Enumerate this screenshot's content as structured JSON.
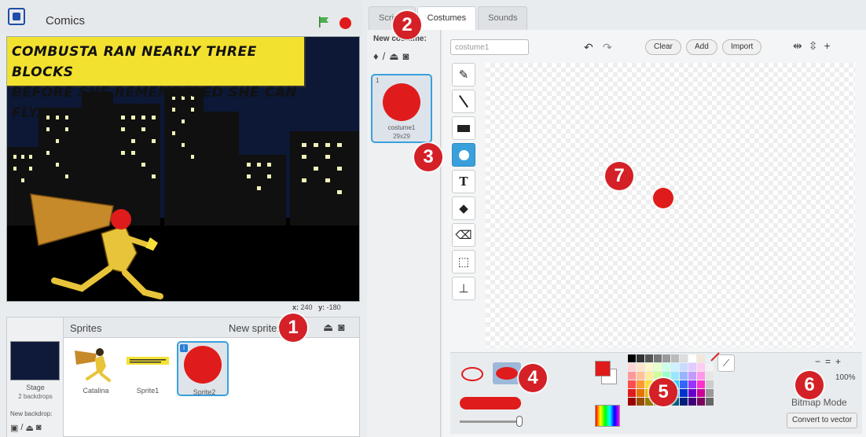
{
  "header": {
    "project_title": "Comics"
  },
  "stage": {
    "caption_line_1": "COMBUSTA RAN NEARLY THREE BLOCKS",
    "caption_line_2": "BEFORE SHE REMEMBERED SHE CAN FLY.",
    "x_label": "x:",
    "x_value": "240",
    "y_label": "y:",
    "y_value": "-180"
  },
  "sprites_pane": {
    "title": "Sprites",
    "new_sprite_label": "New sprite:",
    "stage_label": "Stage",
    "stage_sub": "2 backdrops",
    "new_backdrop_label": "New backdrop:",
    "sprites": [
      {
        "name": "Catalina"
      },
      {
        "name": "Sprite1"
      },
      {
        "name": "Sprite2"
      }
    ]
  },
  "tabs": [
    {
      "label": "Scripts"
    },
    {
      "label": "Costumes"
    },
    {
      "label": "Sounds"
    }
  ],
  "costumes": {
    "new_costume_label": "New costume:",
    "items": [
      {
        "index": "1",
        "name": "costume1",
        "size": "29x29"
      }
    ]
  },
  "editor": {
    "name_input_value": "costume1",
    "clear_label": "Clear",
    "add_label": "Add",
    "import_label": "Import",
    "tool_text_glyph": "T",
    "zoom_level": "100%",
    "mode_label": "Bitmap Mode",
    "convert_label": "Convert to vector"
  },
  "callouts": [
    "1",
    "2",
    "3",
    "4",
    "5",
    "6",
    "7"
  ],
  "colors": {
    "accent": "#3aa0dc",
    "brush": "#e01b1b",
    "callout": "#d42027",
    "caption_bg": "#f3e130"
  },
  "palette": [
    "#000000",
    "#333333",
    "#555555",
    "#777777",
    "#999999",
    "#bbbbbb",
    "#dddddd",
    "#ffffff",
    "#f2e6d9",
    "#e6f0f7",
    "#ffd6d6",
    "#ffe4cc",
    "#fff6cc",
    "#e6ffcc",
    "#ccffe6",
    "#ccf2ff",
    "#ccd9ff",
    "#e0ccff",
    "#ffccf2",
    "#f2f2f2",
    "#ff9999",
    "#ffc299",
    "#ffeb99",
    "#ccff99",
    "#99ffcc",
    "#99e6ff",
    "#99b3ff",
    "#c299ff",
    "#ff99e6",
    "#e6e6e6",
    "#ff4d4d",
    "#ff9933",
    "#ffdd33",
    "#99ff33",
    "#33ff99",
    "#33ccff",
    "#3366ff",
    "#9933ff",
    "#ff33cc",
    "#cccccc",
    "#e01b1b",
    "#e67300",
    "#e6b800",
    "#66cc00",
    "#00cc66",
    "#0099cc",
    "#0033cc",
    "#6600cc",
    "#cc0099",
    "#999999",
    "#990000",
    "#994d00",
    "#997a00",
    "#3d7a00",
    "#007a3d",
    "#005c7a",
    "#001f7a",
    "#3d007a",
    "#7a005c",
    "#666666"
  ],
  "icons": {
    "logo": "app-logo-icon",
    "flag": "green-flag-icon",
    "stop": "stop-icon"
  }
}
